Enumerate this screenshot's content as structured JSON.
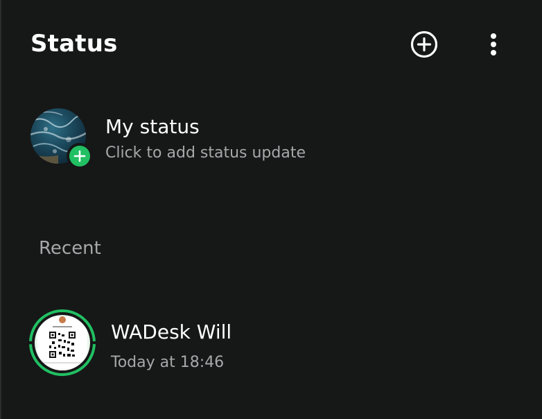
{
  "header": {
    "title": "Status",
    "add_icon": "plus-circle-icon",
    "menu_icon": "more-vertical-icon"
  },
  "my_status": {
    "name": "My status",
    "subtitle": "Click to add status update",
    "badge_icon": "plus-icon"
  },
  "recent": {
    "label": "Recent",
    "items": [
      {
        "name": "WADesk Will",
        "time": "Today at 18:46"
      }
    ]
  },
  "colors": {
    "background": "#161717",
    "accent": "#21c063",
    "primary_text": "#ffffff",
    "secondary_text": "#a5a9aa"
  }
}
